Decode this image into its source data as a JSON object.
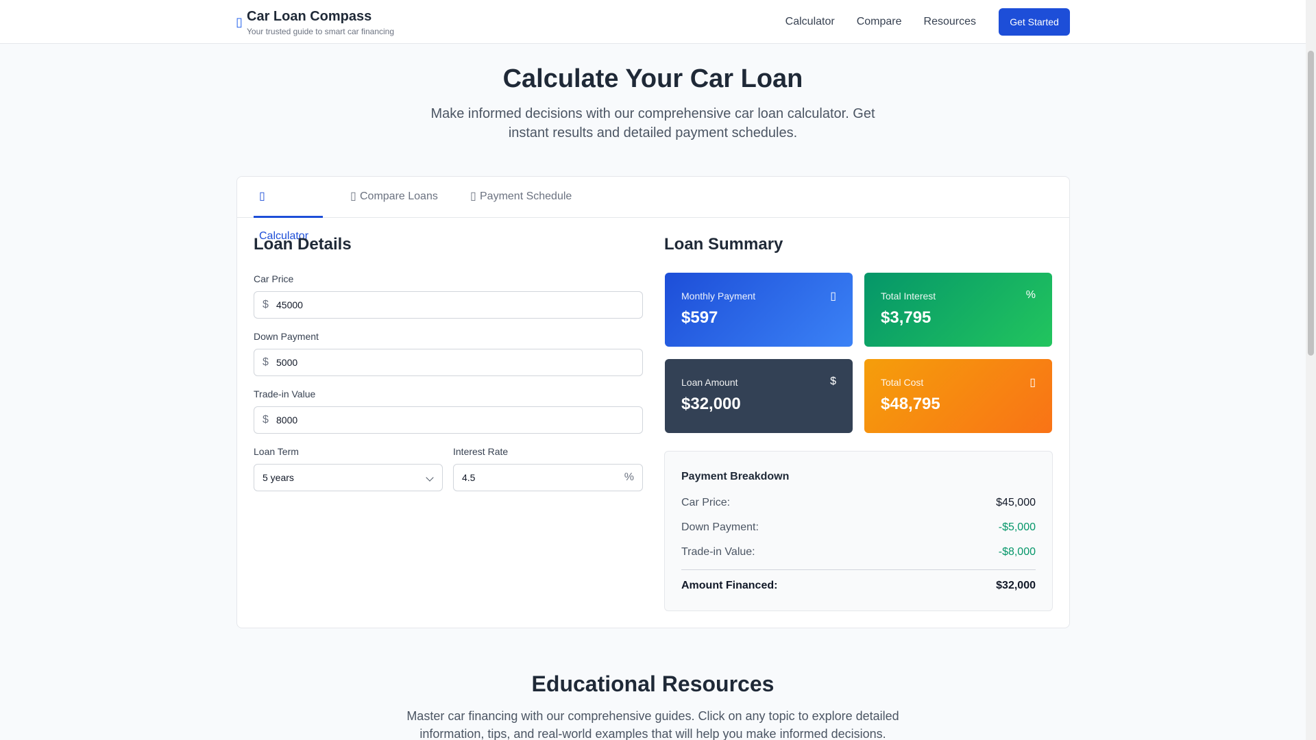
{
  "header": {
    "brand_title": "Car Loan Compass",
    "brand_subtitle": "Your trusted guide to smart car financing",
    "nav": [
      "Calculator",
      "Compare",
      "Resources"
    ],
    "cta": "Get Started"
  },
  "hero": {
    "title": "Calculate Your Car Loan",
    "subtitle": "Make informed decisions with our comprehensive car loan calculator. Get instant results and detailed payment schedules."
  },
  "tabs": [
    "Calculator",
    "Compare Loans",
    "Payment Schedule"
  ],
  "loan_details": {
    "title": "Loan Details",
    "car_price_label": "Car Price",
    "car_price": "45000",
    "down_payment_label": "Down Payment",
    "down_payment": "5000",
    "trade_in_label": "Trade-in Value",
    "trade_in": "8000",
    "currency_symbol": "$",
    "loan_term_label": "Loan Term",
    "loan_term": "5 years",
    "interest_rate_label": "Interest Rate",
    "interest_rate": "4.5",
    "percent_symbol": "%"
  },
  "summary": {
    "title": "Loan Summary",
    "monthly_payment_label": "Monthly Payment",
    "monthly_payment": "$597",
    "total_interest_label": "Total Interest",
    "total_interest": "$3,795",
    "total_interest_icon": "%",
    "loan_amount_label": "Loan Amount",
    "loan_amount": "$32,000",
    "loan_amount_icon": "$",
    "total_cost_label": "Total Cost",
    "total_cost": "$48,795",
    "colors": {
      "monthly": "#1d4ed8",
      "interest": "#059669",
      "loan": "#334155",
      "cost": "#f97316"
    }
  },
  "breakdown": {
    "title": "Payment Breakdown",
    "rows": [
      {
        "label": "Car Price:",
        "value": "$45,000"
      },
      {
        "label": "Down Payment:",
        "value": "-$5,000"
      },
      {
        "label": "Trade-in Value:",
        "value": "-$8,000"
      }
    ],
    "total_label": "Amount Financed:",
    "total_value": "$32,000"
  },
  "education": {
    "title": "Educational Resources",
    "subtitle": "Master car financing with our comprehensive guides. Click on any topic to explore detailed information, tips, and real-world examples that will help you make informed decisions."
  }
}
